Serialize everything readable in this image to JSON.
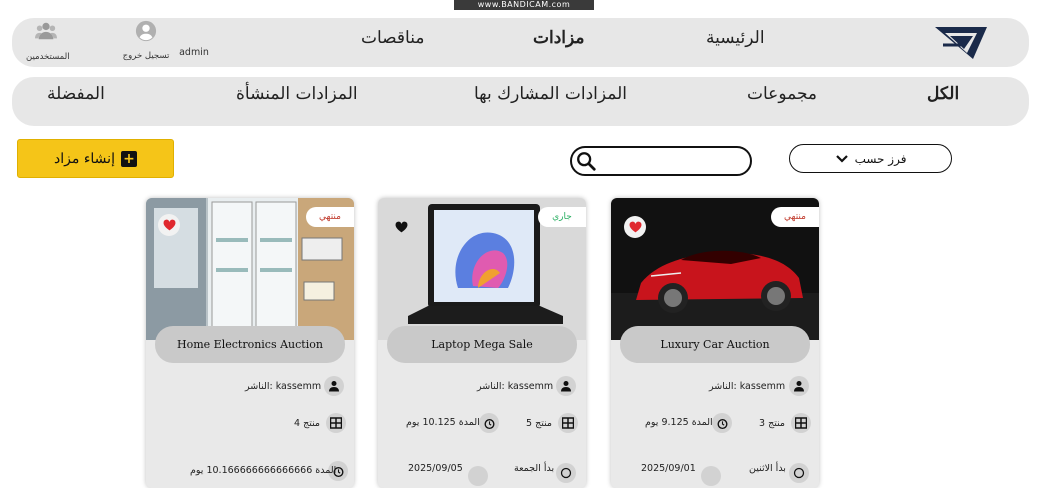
{
  "watermark": "www.BANDICAM.com",
  "header": {
    "users_label": "المستخدمين",
    "logout_label": "تسجيل خروج",
    "username": "admin",
    "nav": {
      "home": "الرئيسية",
      "auctions": "مزادات",
      "tenders": "مناقصات"
    }
  },
  "tabs": {
    "all": "الكل",
    "groups": "مجموعات",
    "participated": "المزادات المشارك بها",
    "created": "المزادات المنشأة",
    "favorites": "المفضلة"
  },
  "toolbar": {
    "create_label": "إنشاء مزاد",
    "search_placeholder": "",
    "sort_label": "فرز حسب"
  },
  "labels": {
    "publisher": "الناشر:",
    "product": "منتج",
    "duration": "المدة",
    "day": "يوم",
    "starts": "بدأ"
  },
  "cards": [
    {
      "title": "Luxury Car Auction",
      "status": "منتهي",
      "favorited": true,
      "publisher": "kassemm",
      "publisher_line": "الناشر: kassemm",
      "products_line": "منتج 3",
      "duration_line": "المدة 9.125 يوم",
      "start_label": "بدأ الاثنين",
      "start_date": "2025/09/01"
    },
    {
      "title": "Laptop Mega Sale",
      "status": "جاري",
      "favorited": false,
      "publisher": "kassemm",
      "publisher_line": "الناشر: kassemm",
      "products_line": "منتج 5",
      "duration_line": "المدة 10.125 يوم",
      "start_label": "بدأ الجمعة",
      "start_date": "2025/09/05"
    },
    {
      "title": "Home Electronics Auction",
      "status": "منتهي",
      "favorited": true,
      "publisher": "kassemm",
      "publisher_line": "الناشر: kassemm",
      "products_line": "منتج 4",
      "duration_line": "المدة 10.166666666666666 يوم",
      "start_label": "",
      "start_date": ""
    }
  ],
  "colors": {
    "accent_yellow": "#f5c518",
    "bar_grey": "#e7e7e7",
    "card_grey": "#e9e9e9",
    "status_ended": "#c0392b",
    "status_running": "#27ae60",
    "heart_red": "#e0282e",
    "logo_navy": "#1a2a4a"
  },
  "icons": {
    "users": "users-icon",
    "logout": "user-circle-icon",
    "search": "search-icon",
    "sort": "chevron-down-icon",
    "create": "plus-square-icon",
    "favorite": "heart-icon",
    "publisher": "person-icon",
    "products": "grid-icon",
    "duration": "alarm-clock-icon",
    "start": "clock-icon"
  }
}
